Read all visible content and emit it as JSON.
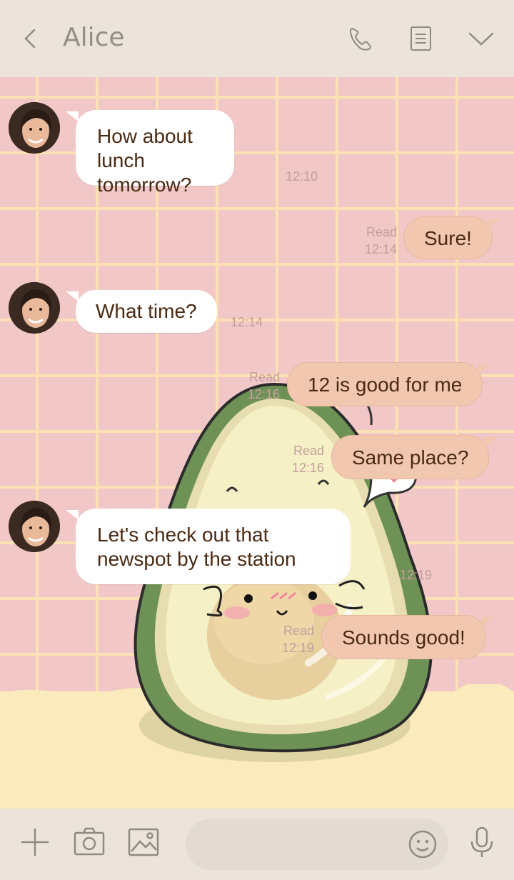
{
  "header": {
    "title": "Alice",
    "icons": [
      "back-arrow-icon",
      "phone-icon",
      "note-icon",
      "chevron-down-icon"
    ]
  },
  "messages": [
    {
      "side": "incoming",
      "text": "How about lunch tomorrow?",
      "time": "12:10"
    },
    {
      "side": "outgoing",
      "text": "Sure!",
      "status": "Read",
      "time": "12:14"
    },
    {
      "side": "incoming",
      "text": "What time?",
      "time": "12:14"
    },
    {
      "side": "outgoing",
      "text": "12 is good for me",
      "status": "Read",
      "time": "12:16"
    },
    {
      "side": "outgoing",
      "text": "Same place?",
      "status": "Read",
      "time": "12:16"
    },
    {
      "side": "incoming",
      "text": "Let's check out that newspot by the station",
      "time": "12:19"
    },
    {
      "side": "outgoing",
      "text": "Sounds good!",
      "status": "Read",
      "time": "12:19"
    }
  ],
  "footer": {
    "input_placeholder": "",
    "icons": [
      "plus-icon",
      "camera-icon",
      "image-icon",
      "emoji-icon",
      "microphone-icon"
    ]
  },
  "colors": {
    "header_bg": "#ece4db",
    "chat_bg": "#f1c7c7",
    "grid_line": "#fbe1b3",
    "outgoing_bubble": "#f1c7b0",
    "incoming_bubble": "#ffffff",
    "message_text": "#4a2a12",
    "meta_text": "#c49f9c"
  }
}
